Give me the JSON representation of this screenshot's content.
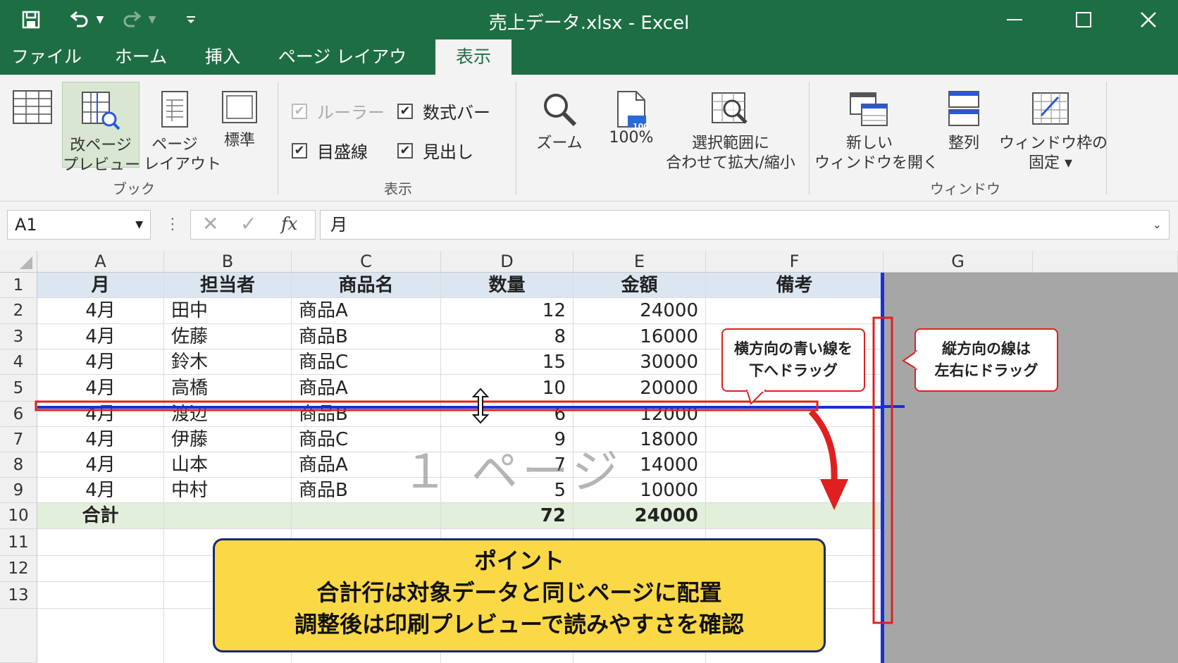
{
  "window": {
    "title": "売上データ.xlsx  -  Excel"
  },
  "quick_access": {
    "save_icon": "save-icon",
    "undo_icon": "undo-icon",
    "redo_icon": "redo-icon",
    "customize_icon": "customize-qat-icon"
  },
  "tabs": [
    {
      "label": "ファイル"
    },
    {
      "label": "ホーム"
    },
    {
      "label": "挿入"
    },
    {
      "label": "ページ レイアウト"
    },
    {
      "label": "表示"
    }
  ],
  "ribbon": {
    "workbook_views": {
      "group_label": "ブック",
      "page_break_preview": "改ページ\nプレビュー",
      "page_layout": "ページ\nレイアウト",
      "normal": "標準"
    },
    "show": {
      "group_label": "表示",
      "ruler": "ルーラー",
      "formula_bar": "数式バー",
      "gridlines": "目盛線",
      "headings": "見出し"
    },
    "zoom": {
      "zoom": "ズーム",
      "zoom_100": "100%",
      "zoom_100_badge": "100",
      "zoom_selection": "選択範囲に\n合わせて拡大/縮小"
    },
    "window": {
      "group_label": "ウィンドウ",
      "new_window": "新しい\nウィンドウを開く",
      "arrange": "整列",
      "freeze": "ウィンドウ枠の\n固定 ▾"
    }
  },
  "formula_bar": {
    "name_box": "A1",
    "fx_label": "fx",
    "value": "月"
  },
  "sheet": {
    "columns": [
      "A",
      "B",
      "C",
      "D",
      "E",
      "F",
      "G"
    ],
    "rows": [
      "1",
      "2",
      "3",
      "4",
      "5",
      "6",
      "7",
      "8",
      "9",
      "10",
      "11",
      "12",
      "13"
    ],
    "header": [
      "月",
      "担当者",
      "商品名",
      "数量",
      "金額",
      "備考"
    ],
    "data": [
      [
        "4月",
        "田中",
        "商品A",
        "12",
        "24000",
        ""
      ],
      [
        "4月",
        "佐藤",
        "商品B",
        "8",
        "16000",
        ""
      ],
      [
        "4月",
        "鈴木",
        "商品C",
        "15",
        "30000",
        ""
      ],
      [
        "4月",
        "高橋",
        "商品A",
        "10",
        "20000",
        ""
      ],
      [
        "4月",
        "渡辺",
        "商品B",
        "6",
        "12000",
        ""
      ],
      [
        "4月",
        "伊藤",
        "商品C",
        "9",
        "18000",
        ""
      ],
      [
        "4月",
        "山本",
        "商品A",
        "7",
        "14000",
        ""
      ],
      [
        "4月",
        "中村",
        "商品B",
        "5",
        "10000",
        ""
      ]
    ],
    "total": [
      "合計",
      "",
      "",
      "72",
      "24000",
      ""
    ],
    "page_label": "１ ページ"
  },
  "annotations": {
    "horizontal_callout": "横方向の青い線を\n下へドラッグ",
    "vertical_callout": "縦方向の線は\n左右にドラッグ",
    "point_box": [
      "ポイント",
      "合計行は対象データと同じページに配置",
      "調整後は印刷プレビューで読みやすさを確認"
    ]
  },
  "colors": {
    "title_bar": "#1e6e43",
    "header_fill": "#dce6f1",
    "total_fill": "#e2efda",
    "page_break_line": "#1a2fd6",
    "highlight": "#e02020",
    "point_fill": "#fbd846"
  }
}
